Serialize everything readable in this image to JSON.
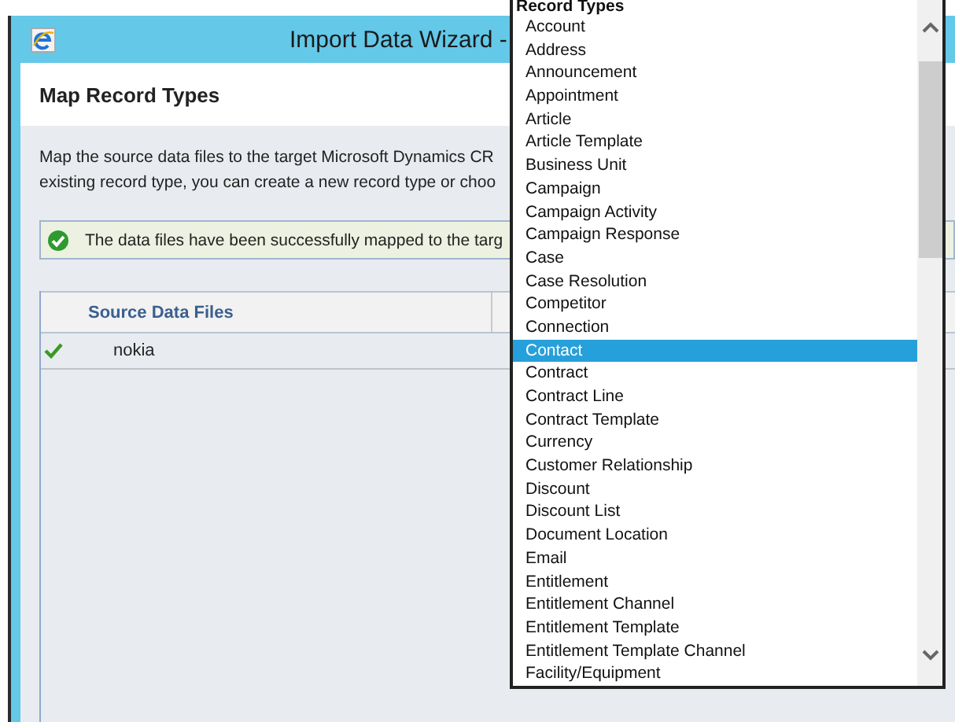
{
  "window": {
    "title": "Import Data Wizard -"
  },
  "page": {
    "heading": "Map Record Types",
    "description_lines": [
      "Map the source data files to the target Microsoft Dynamics CR",
      "existing record type, you can create a new record type or choo"
    ]
  },
  "status": {
    "kind": "success",
    "message": "The data files have been successfully mapped to the targ"
  },
  "table": {
    "columns": [
      "Source Data Files"
    ],
    "rows": [
      {
        "mapped": true,
        "name": "nokia"
      }
    ]
  },
  "dropdown": {
    "header": "Record Types",
    "items": [
      {
        "label": "Account",
        "selected": false
      },
      {
        "label": "Address",
        "selected": false
      },
      {
        "label": "Announcement",
        "selected": false
      },
      {
        "label": "Appointment",
        "selected": false
      },
      {
        "label": "Article",
        "selected": false
      },
      {
        "label": "Article Template",
        "selected": false
      },
      {
        "label": "Business Unit",
        "selected": false
      },
      {
        "label": "Campaign",
        "selected": false
      },
      {
        "label": "Campaign Activity",
        "selected": false
      },
      {
        "label": "Campaign Response",
        "selected": false
      },
      {
        "label": "Case",
        "selected": false
      },
      {
        "label": "Case Resolution",
        "selected": false
      },
      {
        "label": "Competitor",
        "selected": false
      },
      {
        "label": "Connection",
        "selected": false
      },
      {
        "label": "Contact",
        "selected": true
      },
      {
        "label": "Contract",
        "selected": false
      },
      {
        "label": "Contract Line",
        "selected": false
      },
      {
        "label": "Contract Template",
        "selected": false
      },
      {
        "label": "Currency",
        "selected": false
      },
      {
        "label": "Customer Relationship",
        "selected": false
      },
      {
        "label": "Discount",
        "selected": false
      },
      {
        "label": "Discount List",
        "selected": false
      },
      {
        "label": "Document Location",
        "selected": false
      },
      {
        "label": "Email",
        "selected": false
      },
      {
        "label": "Entitlement",
        "selected": false
      },
      {
        "label": "Entitlement Channel",
        "selected": false
      },
      {
        "label": "Entitlement Template",
        "selected": false
      },
      {
        "label": "Entitlement Template Channel",
        "selected": false
      },
      {
        "label": "Facility/Equipment",
        "selected": false
      }
    ]
  }
}
